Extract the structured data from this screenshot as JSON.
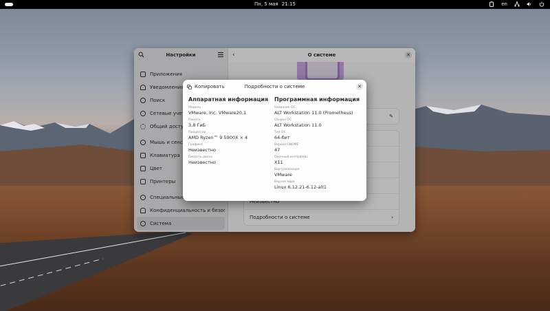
{
  "topbar": {
    "date": "Пн, 5 мая",
    "time": "21:15",
    "keyboard_layout": "en",
    "icons": [
      "clipboard-icon",
      "network-icon",
      "volume-icon",
      "power-icon"
    ]
  },
  "settings": {
    "sidebar_title": "Настройки",
    "items": [
      {
        "label": "Приложения",
        "icon": "apps-icon"
      },
      {
        "label": "Уведомления",
        "icon": "bell-icon"
      },
      {
        "label": "Поиск",
        "icon": "search-icon"
      },
      {
        "label": "Сетевые учетные записи",
        "icon": "online-accounts-icon"
      },
      {
        "label": "Общий доступ",
        "icon": "share-icon"
      },
      {
        "label": "Мышь и сенсорная панель",
        "icon": "mouse-icon"
      },
      {
        "label": "Клавиатура",
        "icon": "keyboard-icon"
      },
      {
        "label": "Цвет",
        "icon": "color-icon"
      },
      {
        "label": "Принтеры",
        "icon": "printer-icon"
      },
      {
        "label": "Специальные возможности",
        "icon": "accessibility-icon"
      },
      {
        "label": "Конфиденциальность и безопасность",
        "icon": "privacy-icon"
      },
      {
        "label": "Система",
        "icon": "system-icon"
      }
    ],
    "main_title": "О системе",
    "rows": {
      "unknown": "Неизвестно",
      "details": "Подробности о системе"
    }
  },
  "dialog": {
    "copy_label": "Копировать",
    "title": "Подробности о системе",
    "hardware": {
      "heading": "Аппаратная информация",
      "fields": [
        {
          "label": "Модель",
          "value": "VMware, Inc. VMware20,1"
        },
        {
          "label": "Память",
          "value": "3,8 ГиБ"
        },
        {
          "label": "Процессор",
          "value": "AMD Ryzen™ 9 5900X × 4"
        },
        {
          "label": "Графика",
          "value": "Неизвестно"
        },
        {
          "label": "Ёмкость диска",
          "value": "Неизвестно"
        }
      ]
    },
    "software": {
      "heading": "Программная информация",
      "fields": [
        {
          "label": "Название ОС",
          "value": "ALT Workstation 11.0 (Prometheus)"
        },
        {
          "label": "Сборка ОС",
          "value": "ALT Workstation 11.0"
        },
        {
          "label": "Тип ОС",
          "value": "64-бит"
        },
        {
          "label": "Версия GNOME",
          "value": "47"
        },
        {
          "label": "Оконный интерфейс",
          "value": "X11"
        },
        {
          "label": "Виртуализация",
          "value": "VMware"
        },
        {
          "label": "Версия ядра",
          "value": "Linux 6.12.21-6.12-alt1"
        }
      ]
    }
  }
}
